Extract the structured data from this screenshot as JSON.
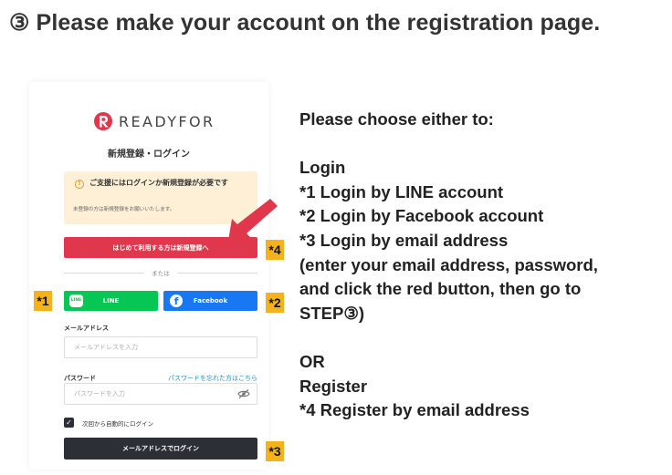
{
  "heading": "③ Please make your account on the registration page.",
  "screenshot": {
    "brand": "READYFOR",
    "title": "新規登録・ログイン",
    "notice_main": "ご支援にはログインか新規登録が必要です",
    "notice_sub": "未登録の方は新規登録をお願いいたします。",
    "register_button": "はじめて利用する方は新規登録へ",
    "or_text": "または",
    "line_button": "LINE",
    "line_icon_text": "LINE",
    "facebook_button": "Facebook",
    "email_label": "メールアドレス",
    "email_placeholder": "メールアドレスを入力",
    "password_label": "パスワード",
    "forgot_link": "パスワードを忘れた方はこちら",
    "password_placeholder": "パスワードを入力",
    "remember_label": "次回から自動的にログイン",
    "remember_checked": true,
    "login_button": "メールアドレスでログイン"
  },
  "badges": {
    "b1": "*1",
    "b2": "*2",
    "b3": "*3",
    "b4": "*4"
  },
  "instructions": [
    "Please choose either to:",
    "",
    "Login",
    "*1 Login by LINE account",
    "*2 Login by Facebook account",
    "*3 Login by email address",
    "(enter your email address, password,",
    "and click the red button, then go to",
    "STEP③)",
    "",
    "OR",
    "Register",
    "*4  Register by email address"
  ],
  "colors": {
    "brand_red": "#e0374c",
    "line_green": "#06c755",
    "facebook_blue": "#1877f2",
    "dark_button": "#2d2f36",
    "notice_bg": "#fdf0d6",
    "badge": "#f5b21b",
    "arrow": "#e0374c"
  }
}
